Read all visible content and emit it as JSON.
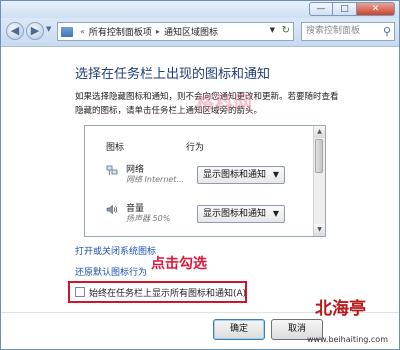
{
  "address_bar": {
    "path": [
      "所有控制面板项",
      "通知区域图标"
    ],
    "search_placeholder": "搜索控制面板"
  },
  "content": {
    "heading": "选择在任务栏上出现的图标和通知",
    "description": "如果选择隐藏图标和通知，则不会向您通知更改和更新。若要随时查看隐藏的图标，请单击任务栏上通知区域旁的箭头。",
    "watermark": "格科网",
    "table_headers": {
      "icons": "图标",
      "behavior": "行为"
    },
    "items": [
      {
        "name": "网络",
        "subtitle": "网络 Internet...",
        "behavior": "显示图标和通知",
        "icon": "network-icon"
      },
      {
        "name": "音量",
        "subtitle": "扬声器 50%",
        "behavior": "显示图标和通知",
        "icon": "volume-icon"
      }
    ],
    "links": {
      "system_icons": "打开或关闭系统图标",
      "restore_defaults": "还原默认图标行为"
    },
    "callout": "点击勾选",
    "always_show": {
      "label": "始终在任务栏上显示所有图标和通知(A)",
      "checked": false
    }
  },
  "buttons": {
    "ok": "确定",
    "cancel": "取消"
  },
  "branding": {
    "name": "北海亭",
    "url": "www.beihaiting.com"
  },
  "colors": {
    "heading": "#1f3d7a",
    "link": "#1a4fb4",
    "highlight": "#d2142b",
    "callout": "#e0173c"
  }
}
